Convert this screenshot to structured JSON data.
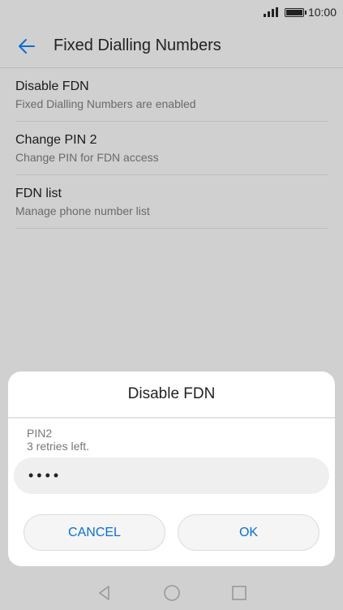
{
  "status": {
    "time": "10:00"
  },
  "appbar": {
    "title": "Fixed Dialling Numbers"
  },
  "list": [
    {
      "title": "Disable FDN",
      "subtitle": "Fixed Dialling Numbers are enabled"
    },
    {
      "title": "Change PIN 2",
      "subtitle": "Change PIN for FDN access"
    },
    {
      "title": "FDN list",
      "subtitle": "Manage phone number list"
    }
  ],
  "dialog": {
    "title": "Disable FDN",
    "pin_label": "PIN2",
    "pin_hint": "3 retries left.",
    "pin_value": "••••",
    "cancel_label": "CANCEL",
    "ok_label": "OK"
  },
  "colors": {
    "accent": "#0a6fd1",
    "background": "#d0d0d0",
    "dialog": "#ffffff"
  },
  "icons": {
    "back": "arrow-left-icon",
    "signal": "signal-icon",
    "battery": "battery-icon",
    "nav_back": "triangle-back-icon",
    "nav_home": "circle-home-icon",
    "nav_recent": "square-recent-icon"
  }
}
